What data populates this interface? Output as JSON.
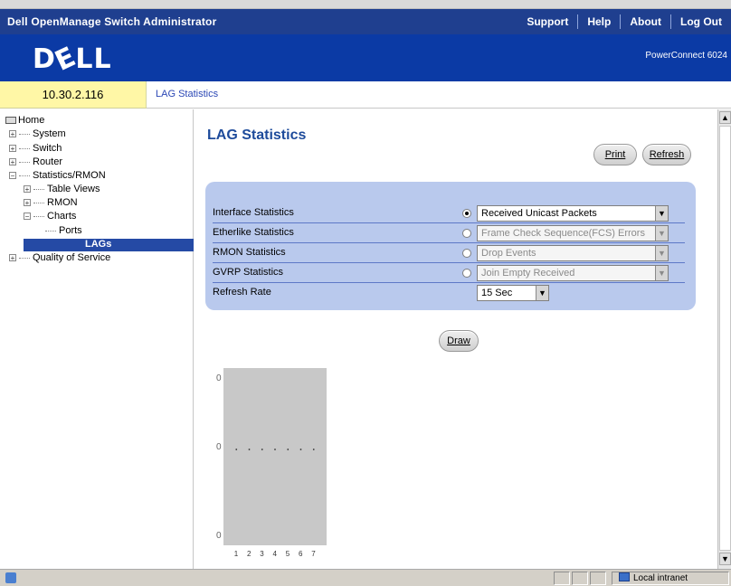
{
  "header": {
    "app_title": "Dell OpenManage Switch Administrator",
    "links": [
      "Support",
      "Help",
      "About",
      "Log Out"
    ],
    "logo": "DELL",
    "product": "PowerConnect 6024"
  },
  "device": {
    "ip": "10.30.2.116"
  },
  "breadcrumb": "LAG Statistics",
  "tree": {
    "home": "Home",
    "system": "System",
    "switch": "Switch",
    "router": "Router",
    "stats": "Statistics/RMON",
    "table_views": "Table Views",
    "rmon": "RMON",
    "charts": "Charts",
    "ports": "Ports",
    "lags": "LAGs",
    "qos": "Quality of Service"
  },
  "main": {
    "title": "LAG Statistics",
    "buttons": {
      "print": "Print",
      "refresh": "Refresh",
      "draw": "Draw"
    },
    "rows": [
      {
        "label": "Interface Statistics",
        "selected": true,
        "value": "Received Unicast Packets",
        "disabled": false
      },
      {
        "label": "Etherlike Statistics",
        "selected": false,
        "value": "Frame Check Sequence(FCS) Errors",
        "disabled": true
      },
      {
        "label": "RMON Statistics",
        "selected": false,
        "value": "Drop Events",
        "disabled": true
      },
      {
        "label": "GVRP Statistics",
        "selected": false,
        "value": "Join Empty Received",
        "disabled": true
      }
    ],
    "refresh_rate": {
      "label": "Refresh Rate",
      "value": "15 Sec"
    }
  },
  "chart_data": {
    "type": "scatter",
    "x": [
      1,
      2,
      3,
      4,
      5,
      6,
      7
    ],
    "y": [
      0,
      0,
      0,
      0,
      0,
      0,
      0
    ],
    "y_ticks": [
      "0",
      "0",
      "0"
    ],
    "x_ticks": [
      "1",
      "2",
      "3",
      "4",
      "5",
      "6",
      "7"
    ],
    "background": "#c8c8c8"
  },
  "status": {
    "zone": "Local intranet"
  },
  "colors": {
    "titlebar": "#1f3f8f",
    "banner": "#0b3aa5",
    "panel": "#b9c9ed",
    "ip_box": "#fff7a6",
    "title_text": "#1e4b9b"
  }
}
